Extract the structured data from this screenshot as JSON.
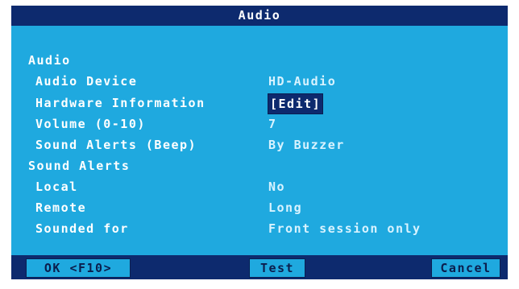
{
  "window": {
    "title": "Audio"
  },
  "audio_section": {
    "heading": "Audio",
    "device_label": "Audio Device",
    "device_value": "HD-Audio",
    "hw_info_label": "Hardware Information",
    "hw_info_button": "[Edit]",
    "volume_label": "Volume (0-10)",
    "volume_value": "7",
    "beep_label": "Sound Alerts (Beep)",
    "beep_value": "By Buzzer"
  },
  "alerts_section": {
    "heading": "Sound Alerts",
    "local_label": "Local",
    "local_value": "No",
    "remote_label": "Remote",
    "remote_value": "Long",
    "sounded_label": "Sounded for",
    "sounded_value": "Front session only"
  },
  "buttons": {
    "ok": "OK <F10>",
    "test": "Test",
    "cancel": "Cancel"
  },
  "colors": {
    "dialog_bg": "#1fa9df",
    "title_bg": "#0d2a6e",
    "text": "#ffffff"
  }
}
